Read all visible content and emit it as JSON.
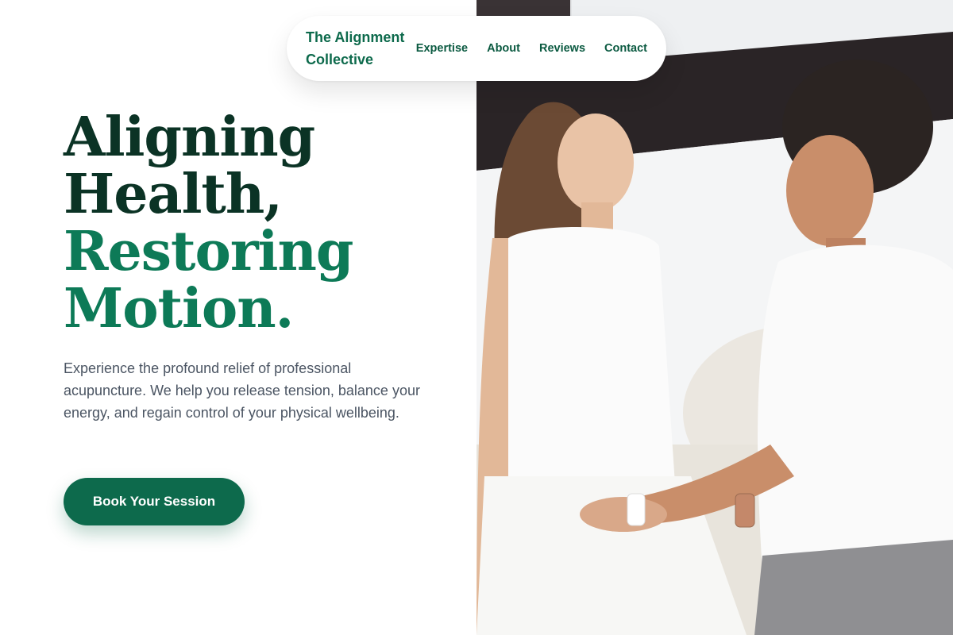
{
  "brand": {
    "name": "The Alignment Collective"
  },
  "nav": {
    "links": [
      {
        "label": "Expertise"
      },
      {
        "label": "About"
      },
      {
        "label": "Reviews"
      },
      {
        "label": "Contact"
      }
    ]
  },
  "hero": {
    "headline_line1": "Aligning",
    "headline_line2": "Health,",
    "headline_line3": "Restoring",
    "headline_line4": "Motion.",
    "lead": "Experience the profound relief of professional acupuncture. We help you release tension, balance your energy, and regain control of your physical wellbeing.",
    "cta_label": "Book Your Session"
  },
  "colors": {
    "brand_green": "#0d6a4c",
    "headline_dark": "#0b3325",
    "headline_green": "#0d7a57",
    "body_text": "#4b5563"
  }
}
